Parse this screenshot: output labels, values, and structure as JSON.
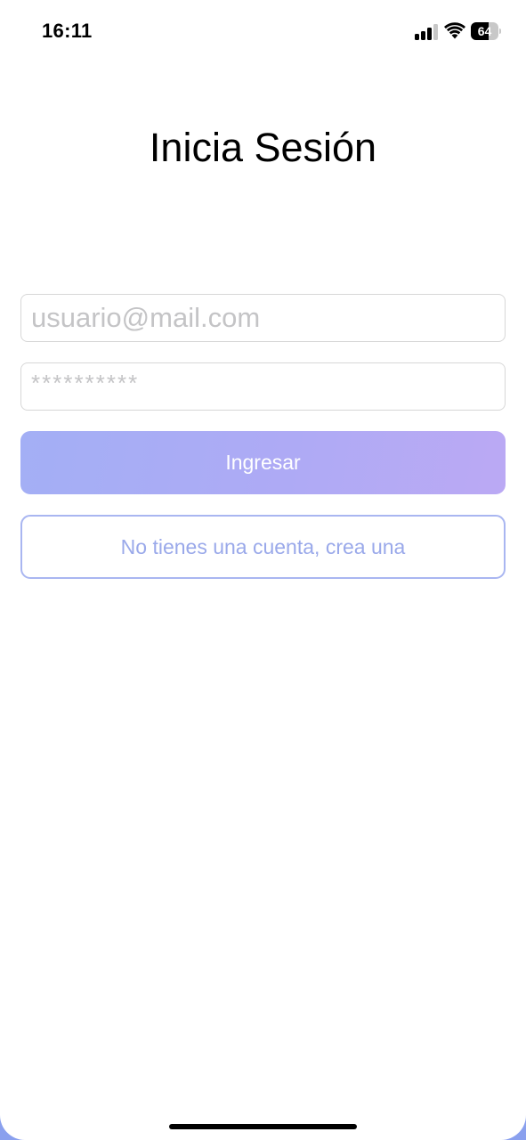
{
  "status_bar": {
    "time": "16:11",
    "signal_icon": "cellular-signal-icon",
    "wifi_icon": "wifi-icon",
    "battery_level": "64",
    "battery_percent": 64
  },
  "login": {
    "title": "Inicia Sesión",
    "email_placeholder": "usuario@mail.com",
    "password_placeholder": "**********",
    "submit_label": "Ingresar",
    "signup_label": "No tienes una cuenta, crea una"
  },
  "colors": {
    "primary_gradient_start": "#a3aff5",
    "primary_gradient_end": "#bba9f4",
    "accent": "#9aa9ea",
    "input_border": "#d7d7d7"
  }
}
